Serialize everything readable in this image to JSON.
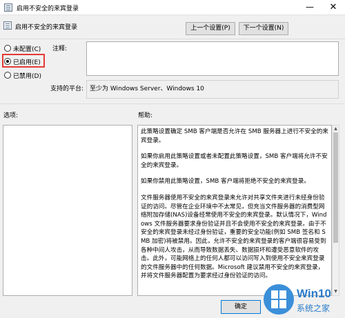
{
  "window": {
    "title": "启用不安全的来宾登录"
  },
  "header": {
    "title": "启用不安全的来宾登录",
    "prev_label": "上一个设置(P)",
    "next_label": "下一个设置(N)"
  },
  "radios": [
    {
      "label": "未配置(C)",
      "checked": false
    },
    {
      "label": "已启用(E)",
      "checked": true
    },
    {
      "label": "已禁用(D)",
      "checked": false
    }
  ],
  "comment": {
    "label": "注释:",
    "value": ""
  },
  "platform": {
    "label": "支持的平台:",
    "value": "至少为 Windows Server、Windows 10"
  },
  "options": {
    "label": "选项:"
  },
  "help": {
    "label": "帮助:",
    "paragraphs": [
      "此策略设置确定 SMB 客户端是否允许在 SMB 服务器上进行不安全的来宾登录。",
      "如果你启用此策略设置或者未配置此策略设置，SMB 客户端将允许不安全的来宾登录。",
      "如果你禁用此策略设置，SMB 客户端将拒绝不安全的来宾登录。",
      "文件服务器使用不安全的来宾登录来允许对共享文件夹进行未经身份验证的访问。尽管在企业环境中不太常见，但充当文件服务器的消费型网络附加存储(NAS)设备经常使用不安全的来宾登录。默认情况下，Windows 文件服务器要求身份验证并且不会使用不安全的来宾登录。由于不安全的来宾登录未经过身份验证，重要的安全功能(例如 SMB 签名和 SMB 加密)将被禁用。因此，允许不安全的来宾登录的客户端很容易受到各种中间人攻击，从而导致数据丢失、数据损坏和遭受恶意软件的攻击。此外，可能网络上的任何人都可以访问写入到使用不安全来宾登录的文件服务器中的任何数据。Microsoft 建议禁用不安全的来宾登录，并将文件服务器配置为要求经过身份验证的访问。"
    ]
  },
  "footer": {
    "ok_label": "确定"
  },
  "watermark": {
    "line1": "Win10",
    "line2": "系统之家"
  },
  "colors": {
    "highlight": "#e53935",
    "accent": "#0078d7"
  }
}
